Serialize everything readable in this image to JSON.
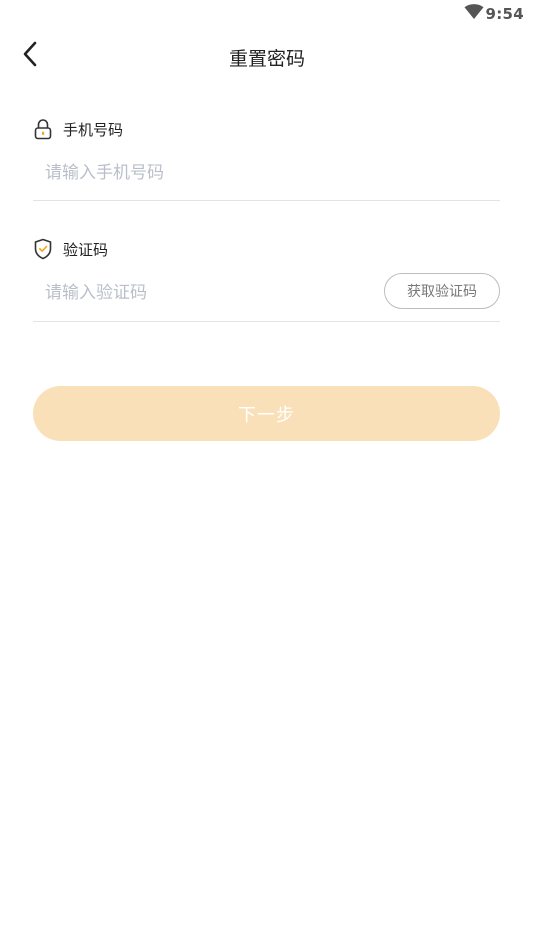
{
  "status_bar": {
    "time": "9:54",
    "wifi_icon": "wifi-icon"
  },
  "nav": {
    "back_icon": "chevron-left-icon",
    "title": "重置密码"
  },
  "form": {
    "phone": {
      "icon": "lock-icon",
      "label": "手机号码",
      "placeholder": "请输入手机号码",
      "value": ""
    },
    "code": {
      "icon": "shield-check-icon",
      "label": "验证码",
      "placeholder": "请输入验证码",
      "value": "",
      "get_code_label": "获取验证码"
    }
  },
  "actions": {
    "next_label": "下一步"
  },
  "colors": {
    "accent": "#fae0b8",
    "icon_accent": "#f5a623",
    "placeholder": "#b9bfca",
    "divider": "#e3e3e3"
  }
}
